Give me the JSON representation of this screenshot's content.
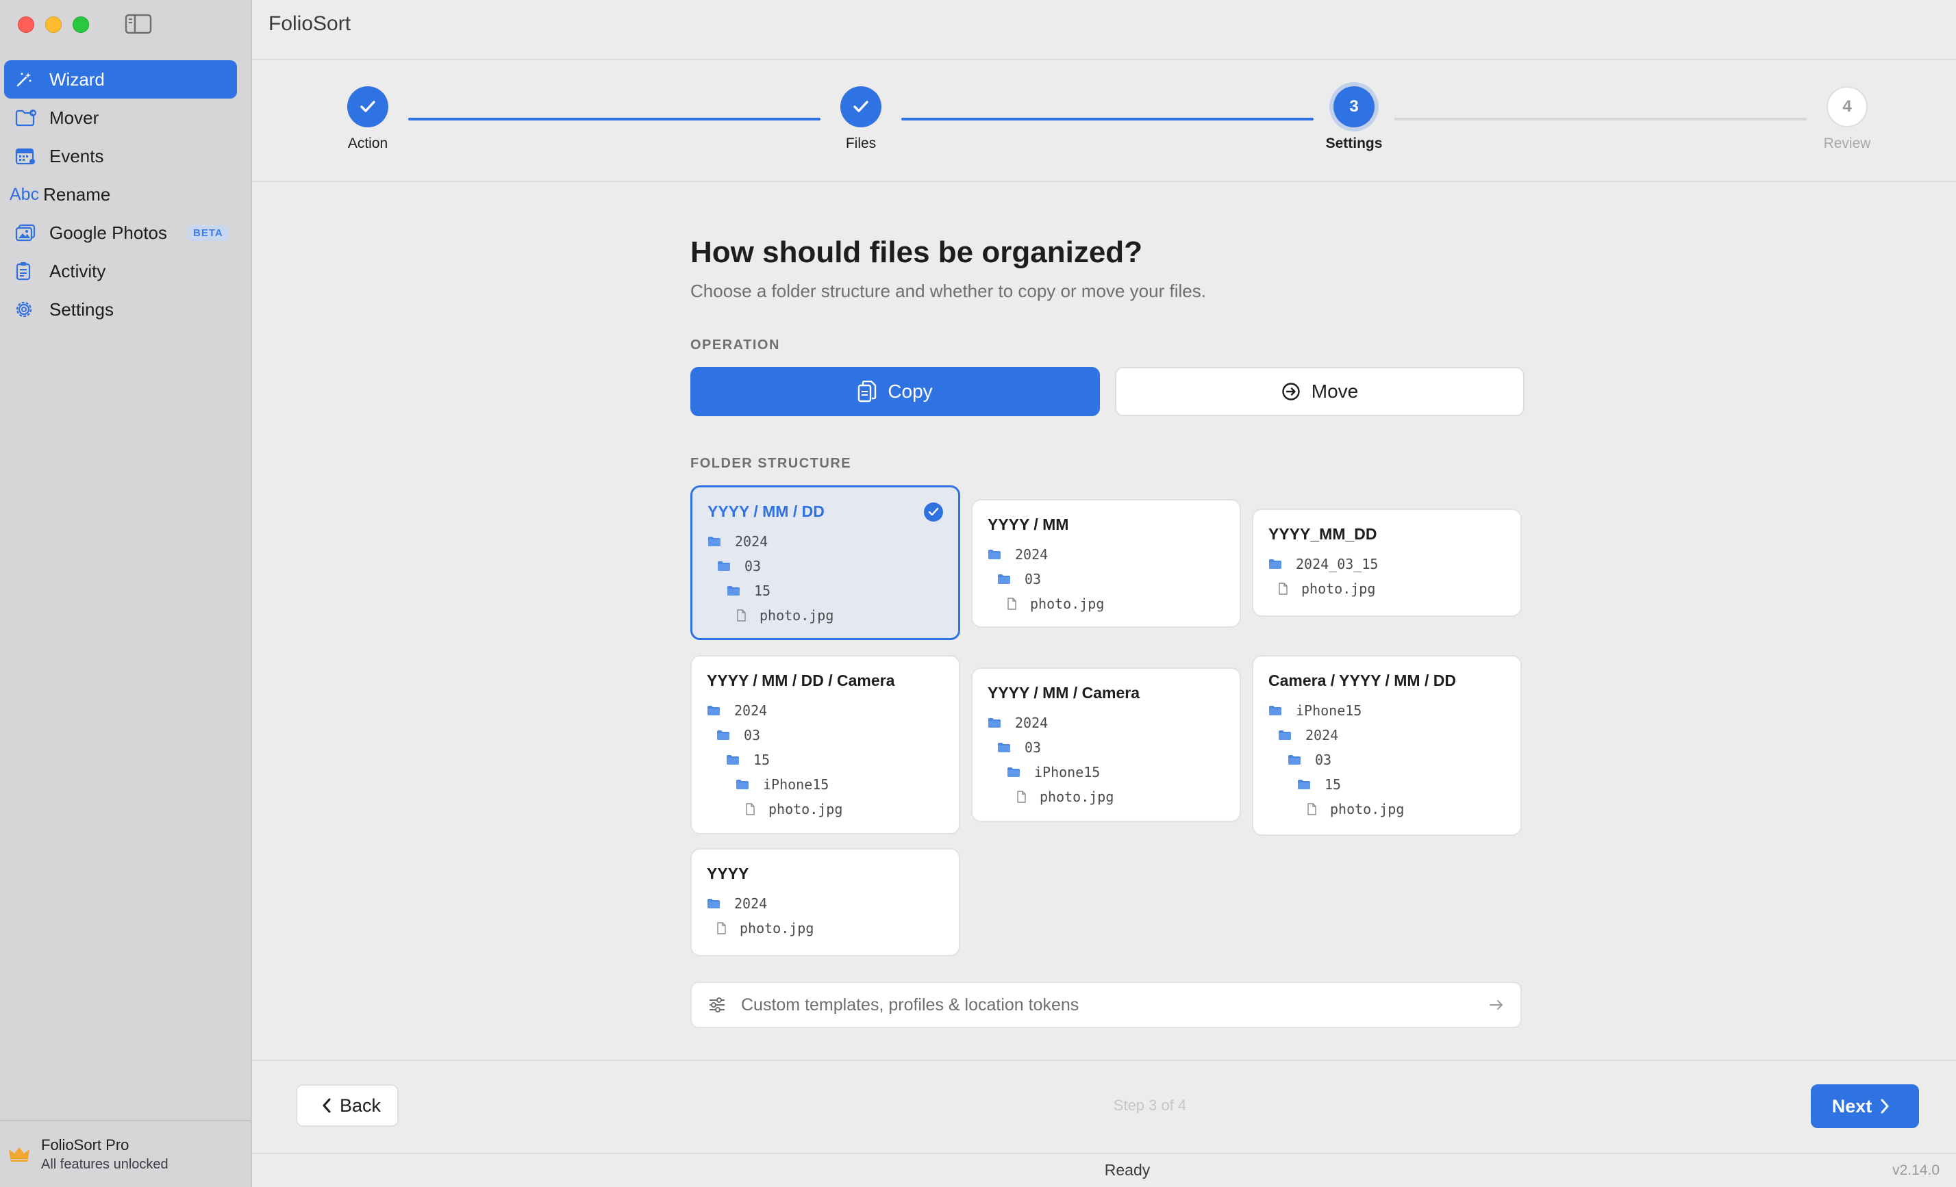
{
  "app": {
    "title": "FolioSort"
  },
  "sidebar": {
    "items": [
      {
        "label": "Wizard",
        "icon": "magic-wand-icon",
        "active": true
      },
      {
        "label": "Mover",
        "icon": "folder-move-icon"
      },
      {
        "label": "Events",
        "icon": "calendar-icon"
      },
      {
        "label": "Rename",
        "icon": "abc-icon",
        "icon_text": "Abc"
      },
      {
        "label": "Google Photos",
        "icon": "photos-icon",
        "badge": "BETA"
      },
      {
        "label": "Activity",
        "icon": "clipboard-icon"
      },
      {
        "label": "Settings",
        "icon": "gear-icon"
      }
    ],
    "footer": {
      "title": "FolioSort Pro",
      "subtitle": "All features unlocked",
      "icon": "crown-icon"
    }
  },
  "stepper": {
    "steps": [
      {
        "label": "Action",
        "state": "done"
      },
      {
        "label": "Files",
        "state": "done"
      },
      {
        "label": "Settings",
        "state": "current",
        "number": "3"
      },
      {
        "label": "Review",
        "state": "pending",
        "number": "4"
      }
    ]
  },
  "main": {
    "heading": "How should files be organized?",
    "subheading": "Choose a folder structure and whether to copy or move your files.",
    "operation": {
      "label": "OPERATION",
      "copy_label": "Copy",
      "move_label": "Move",
      "selected": "Copy"
    },
    "folder_structure": {
      "label": "FOLDER STRUCTURE",
      "cards": [
        {
          "title": "YYYY / MM / DD",
          "selected": true,
          "tree": [
            "2024",
            "03",
            "15",
            "photo.jpg"
          ]
        },
        {
          "title": "YYYY / MM",
          "tree": [
            "2024",
            "03",
            "photo.jpg"
          ]
        },
        {
          "title": "YYYY_MM_DD",
          "tree": [
            "2024_03_15",
            "photo.jpg"
          ]
        },
        {
          "title": "YYYY / MM / DD / Camera",
          "tree": [
            "2024",
            "03",
            "15",
            "iPhone15",
            "photo.jpg"
          ]
        },
        {
          "title": "YYYY / MM / Camera",
          "tree": [
            "2024",
            "03",
            "iPhone15",
            "photo.jpg"
          ]
        },
        {
          "title": "Camera / YYYY / MM / DD",
          "tree": [
            "iPhone15",
            "2024",
            "03",
            "15",
            "photo.jpg"
          ]
        },
        {
          "title": "YYYY",
          "tree": [
            "2024",
            "photo.jpg"
          ]
        }
      ]
    },
    "custom_link": "Custom templates, profiles & location tokens"
  },
  "footer": {
    "back_label": "Back",
    "step_text": "Step 3 of 4",
    "next_label": "Next"
  },
  "status": {
    "text": "Ready",
    "version": "v2.14.0"
  },
  "colors": {
    "accent": "#2f72e2",
    "sidebar_bg": "#d6d6d8",
    "window_bg": "#ececec"
  }
}
